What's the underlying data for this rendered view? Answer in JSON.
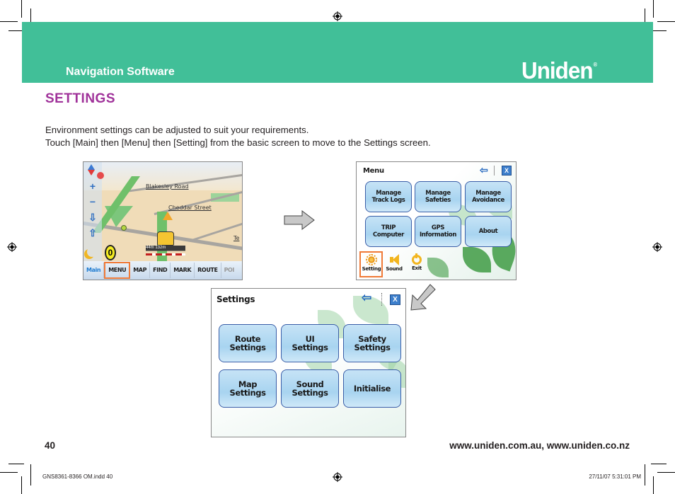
{
  "header": {
    "section": "Navigation Software",
    "brand": "Uniden",
    "brand_mark": "®",
    "background_color": "#41bf98"
  },
  "page": {
    "title": "SETTINGS",
    "title_color": "#a0329a",
    "paragraphs": [
      "Environment settings can be adjusted to suit your requirements.",
      "Touch [Main] then [Menu] then [Setting] from the basic screen to move to the Settings screen."
    ]
  },
  "map_screen": {
    "street_labels": [
      "Blakesley Road",
      "Cheddar Street",
      "Te"
    ],
    "scale_text": "44m  132m",
    "speed_indicator": "0",
    "toolbar": [
      "Main",
      "MENU",
      "MAP",
      "FIND",
      "MARK",
      "ROUTE",
      "POI"
    ],
    "highlighted": "MENU",
    "side_controls": [
      "compass-icon",
      "zoom-in-icon",
      "zoom-out-icon",
      "tilt-down-icon",
      "tilt-up-icon",
      "night-mode-icon"
    ]
  },
  "menu_screen": {
    "title": "Menu",
    "buttons": [
      {
        "line1": "Manage",
        "line2": "Track Logs"
      },
      {
        "line1": "Manage",
        "line2": "Safeties"
      },
      {
        "line1": "Manage",
        "line2": "Avoidance"
      },
      {
        "line1": "TRIP",
        "line2": "Computer"
      },
      {
        "line1": "GPS",
        "line2": "Information"
      },
      {
        "line1": "About",
        "line2": ""
      }
    ],
    "bottom_icons": [
      {
        "label": "Setting",
        "icon": "gear-icon"
      },
      {
        "label": "Sound",
        "icon": "speaker-icon"
      },
      {
        "label": "Exit",
        "icon": "power-icon"
      }
    ],
    "highlighted": "Setting",
    "close_glyph": "X",
    "back_glyph": "⇦"
  },
  "settings_screen": {
    "title": "Settings",
    "buttons": [
      {
        "line1": "Route",
        "line2": "Settings"
      },
      {
        "line1": "UI",
        "line2": "Settings"
      },
      {
        "line1": "Safety",
        "line2": "Settings"
      },
      {
        "line1": "Map",
        "line2": "Settings"
      },
      {
        "line1": "Sound",
        "line2": "Settings"
      },
      {
        "line1": "Initialise",
        "line2": ""
      }
    ],
    "close_glyph": "X",
    "back_glyph": "⇦"
  },
  "footer": {
    "page_number": "40",
    "urls": "www.uniden.com.au, www.uniden.co.nz"
  },
  "slug": {
    "file": "GNS8361-8366 OM.indd   40",
    "timestamp": "27/11/07   5:31:01 PM"
  }
}
